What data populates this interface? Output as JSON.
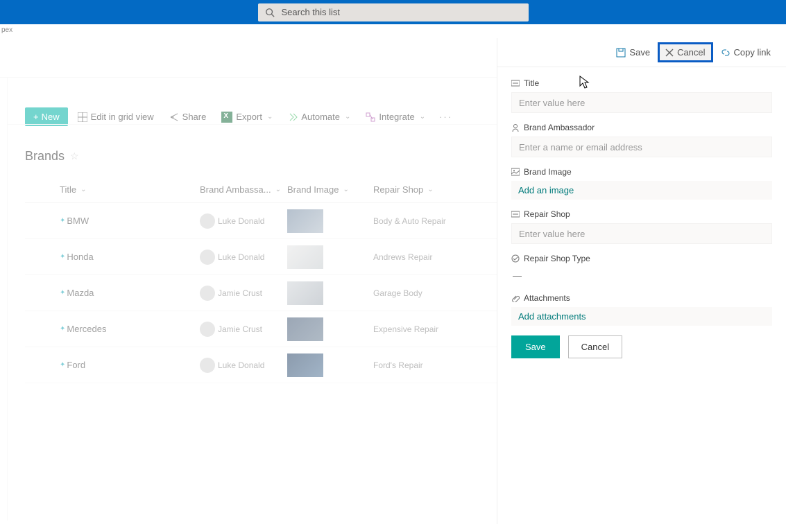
{
  "search": {
    "placeholder": "Search this list"
  },
  "breadcrumb": "pex",
  "toolbar": {
    "new_label": "New",
    "edit_grid": "Edit in grid view",
    "share": "Share",
    "export": "Export",
    "automate": "Automate",
    "integrate": "Integrate"
  },
  "list": {
    "title": "Brands",
    "columns": {
      "title": "Title",
      "ambassador": "Brand Ambassa...",
      "image": "Brand Image",
      "shop": "Repair Shop"
    },
    "rows": [
      {
        "title": "BMW",
        "ambassador": "Luke Donald",
        "shop": "Body & Auto Repair"
      },
      {
        "title": "Honda",
        "ambassador": "Luke Donald",
        "shop": "Andrews Repair"
      },
      {
        "title": "Mazda",
        "ambassador": "Jamie Crust",
        "shop": "Garage Body"
      },
      {
        "title": "Mercedes",
        "ambassador": "Jamie Crust",
        "shop": "Expensive Repair"
      },
      {
        "title": "Ford",
        "ambassador": "Luke Donald",
        "shop": "Ford's Repair"
      }
    ]
  },
  "panel": {
    "save": "Save",
    "cancel": "Cancel",
    "copy_link": "Copy link",
    "fields": {
      "title": {
        "label": "Title",
        "placeholder": "Enter value here"
      },
      "ambassador": {
        "label": "Brand Ambassador",
        "placeholder": "Enter a name or email address"
      },
      "image": {
        "label": "Brand Image",
        "action": "Add an image"
      },
      "shop": {
        "label": "Repair Shop",
        "placeholder": "Enter value here"
      },
      "shop_type": {
        "label": "Repair Shop Type",
        "value": "—"
      },
      "attachments": {
        "label": "Attachments",
        "action": "Add attachments"
      }
    },
    "footer": {
      "save": "Save",
      "cancel": "Cancel"
    }
  }
}
